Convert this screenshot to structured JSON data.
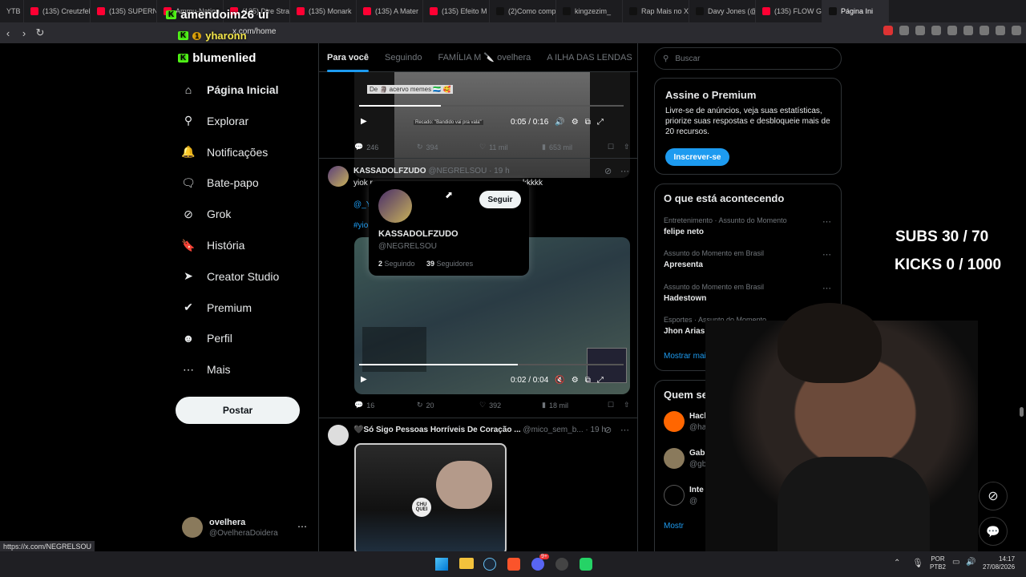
{
  "browser": {
    "tabs": [
      {
        "label": "YTB",
        "color": "#444"
      },
      {
        "label": "(135) Creutzfel",
        "color": "#ff0033"
      },
      {
        "label": "(135) SUPERNA",
        "color": "#ff0033"
      },
      {
        "label": "Ammu-Nation",
        "color": "#ff0033"
      },
      {
        "label": "(135) Dire Stra",
        "color": "#ff0033"
      },
      {
        "label": "(135) Monark",
        "color": "#ff0033"
      },
      {
        "label": "(135) A Mater",
        "color": "#ff0033"
      },
      {
        "label": "(135) Efeito M",
        "color": "#ff0033"
      },
      {
        "label": "(2)Como comp",
        "color": "#111"
      },
      {
        "label": "kingzezim_",
        "color": "#111"
      },
      {
        "label": "Rap Mais no X",
        "color": "#111"
      },
      {
        "label": "Davy Jones (@",
        "color": "#111"
      },
      {
        "label": "(135) FLOW G",
        "color": "#ff0033"
      },
      {
        "label": "Página Ini",
        "color": "#111",
        "active": true
      }
    ],
    "url": "x.com/home",
    "status_url": "https://x.com/NEGRELSOU"
  },
  "kick_overlay": [
    {
      "name": "amendoim26",
      "badge": "ui"
    },
    {
      "name": "yharonn",
      "badge": "1"
    },
    {
      "name": "blumenlied",
      "badge": ""
    }
  ],
  "nav": [
    {
      "id": "home",
      "label": "Página Inicial",
      "icon": "home-icon",
      "active": true
    },
    {
      "id": "explore",
      "label": "Explorar",
      "icon": "search-icon"
    },
    {
      "id": "notifications",
      "label": "Notificações",
      "icon": "bell-icon"
    },
    {
      "id": "chat",
      "label": "Bate-papo",
      "icon": "chat-icon"
    },
    {
      "id": "grok",
      "label": "Grok",
      "icon": "grok-icon"
    },
    {
      "id": "history",
      "label": "História",
      "icon": "bookmark-icon"
    },
    {
      "id": "creator",
      "label": "Creator Studio",
      "icon": "rocket-icon"
    },
    {
      "id": "premium",
      "label": "Premium",
      "icon": "verified-icon"
    },
    {
      "id": "profile",
      "label": "Perfil",
      "icon": "person-icon"
    },
    {
      "id": "more",
      "label": "Mais",
      "icon": "more-circle-icon"
    }
  ],
  "post_button": "Postar",
  "account": {
    "name": "ovelhera",
    "handle": "@OvelheraDoidera"
  },
  "timeline_tabs": [
    "Para você",
    "Seguindo",
    "FAMÍLIA M 🔪 ovelhera",
    "A ILHA DAS LENDAS"
  ],
  "post1": {
    "video_caption": "De 🗿 acervo memes 🇸🇱 🥰",
    "video_subtitle": "Recado: \"Bandido vai pra vala\"",
    "time": "0:05 / 0:16",
    "replies": "246",
    "reposts": "394",
    "likes": "11 mil",
    "views": "653 mil"
  },
  "post2": {
    "author": "KASSADOLFZUDO",
    "handle": "@NEGRELSOU",
    "age": "· 19 h",
    "text": "yiok r",
    "text_tail": "kkkkk",
    "mention": "@_Y",
    "hashtag": "#yio",
    "time": "0:02 / 0:04",
    "replies": "16",
    "reposts": "20",
    "likes": "392",
    "views": "18 mil"
  },
  "hover_card": {
    "name": "KASSADOLFZUDO",
    "handle": "@NEGRELSOU",
    "follow": "Seguir",
    "following_count": "2",
    "following_label": "Seguindo",
    "followers_count": "39",
    "followers_label": "Seguidores"
  },
  "post3": {
    "author": "🖤Só Sigo Pessoas Horríveis De Coração ...",
    "handle": "@mico_sem_b...",
    "age": "· 19 h",
    "badge": "CHU QUEI"
  },
  "search": {
    "placeholder": "Buscar"
  },
  "premium": {
    "title": "Assine o Premium",
    "body": "Livre-se de anúncios, veja suas estatísticas, priorize suas respostas e desbloqueie mais de 20 recursos.",
    "button": "Inscrever-se"
  },
  "trends": {
    "title": "O que está acontecendo",
    "items": [
      {
        "context": "Entretenimento · Assunto do Momento",
        "name": "felipe neto"
      },
      {
        "context": "Assunto do Momento em Brasil",
        "name": "Apresenta"
      },
      {
        "context": "Assunto do Momento em Brasil",
        "name": "Hadestown"
      },
      {
        "context": "Esportes · Assunto do Momento",
        "name": "Jhon Arias"
      }
    ],
    "show_more": "Mostrar mais"
  },
  "who_to_follow": {
    "title": "Quem seguir",
    "items": [
      {
        "name": "Hacker News",
        "handle": "@hackernews"
      },
      {
        "name": "Gabriel",
        "handle": "@gbrlm"
      },
      {
        "name": "Inte",
        "handle": "@"
      }
    ],
    "show_more": "Mostr"
  },
  "stream_overlay": {
    "subs": "SUBS 30 / 70",
    "kicks": "KICKS 0 / 1000"
  },
  "taskbar": {
    "lang": "POR",
    "layout": "PTB2",
    "time": "14:17",
    "date": "27/08/2026",
    "badge": "9+"
  },
  "colors": {
    "accent": "#1d9bf0",
    "kick_green": "#53fc18"
  }
}
